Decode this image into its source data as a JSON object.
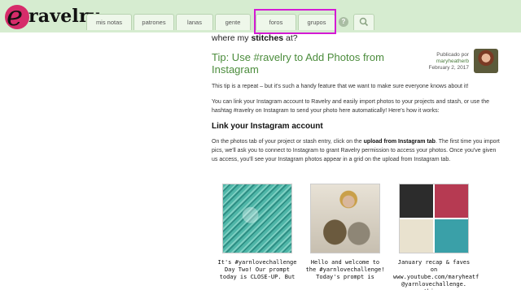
{
  "brand": {
    "logo_text": "ravelry"
  },
  "nav": {
    "tabs": [
      "mis notas",
      "patrones",
      "lanas",
      "gente",
      "foros",
      "grupos"
    ],
    "help_glyph": "?",
    "search_icon": "search-icon"
  },
  "tagline": {
    "prefix": "where my ",
    "bold": "stitches",
    "suffix": " at?"
  },
  "post": {
    "title": "Tip: Use #ravelry to Add Photos from Instagram",
    "byline": {
      "published_label": "Publicado por",
      "author": "maryheatherb",
      "date": "February 2, 2017"
    },
    "intro": "This tip is a repeat – but it's such a handy feature that we want to make sure everyone knows about it!",
    "para2": "You can link your Instagram account to Ravelry and easily import photos to your projects and stash, or use the hashtag #ravelry on Instagram to send your photo here automatically! Here's how it works:",
    "section_heading": "Link your Instagram account",
    "para3_before": "On the photos tab of your project or stash entry, click on the ",
    "para3_bold": "upload from Instagram tab",
    "para3_after": ". The first time you import pics, we'll ask you to connect to Instagram to grant Ravelry permission to access your photos. Once you've given us access, you'll see your Instagram photos appear in a grid on the upload from Instagram tab."
  },
  "photos": [
    {
      "caption": "It's #yarnlovechallenge Day Two! Our prompt today is CLOSE-UP. But"
    },
    {
      "caption": "Hello and welcome to the #yarnlovechallenge! Today's prompt is"
    },
    {
      "caption": "January recap & faves on www.youtube.com/maryheatf @yarnlovechallenge. thinos"
    }
  ],
  "colors": {
    "topbar": "#d6ecd0",
    "title_green": "#4b8c3c",
    "highlight": "#d41ad4",
    "logo_circle": "#d62c6a"
  }
}
